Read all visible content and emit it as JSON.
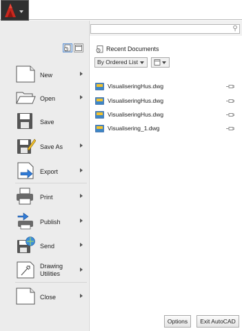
{
  "search": {
    "placeholder": "",
    "value": ""
  },
  "menu": {
    "items": [
      {
        "label": "New",
        "has_submenu": true,
        "icon": "new-document-icon"
      },
      {
        "label": "Open",
        "has_submenu": true,
        "icon": "open-folder-icon"
      },
      {
        "label": "Save",
        "has_submenu": false,
        "icon": "save-disk-icon"
      },
      {
        "label": "Save As",
        "has_submenu": true,
        "icon": "save-as-icon"
      },
      {
        "label": "Export",
        "has_submenu": true,
        "icon": "export-icon"
      },
      {
        "label": "Print",
        "has_submenu": true,
        "icon": "printer-icon"
      },
      {
        "label": "Publish",
        "has_submenu": true,
        "icon": "publish-icon"
      },
      {
        "label": "Send",
        "has_submenu": true,
        "icon": "send-icon"
      },
      {
        "label": "Drawing Utilities",
        "line1": "Drawing",
        "line2": "Utilities",
        "has_submenu": true,
        "icon": "drawing-utilities-icon"
      },
      {
        "label": "Close",
        "has_submenu": true,
        "icon": "close-document-icon"
      }
    ]
  },
  "recent": {
    "title": "Recent Documents",
    "order_by": "By Ordered List",
    "documents": [
      {
        "name": "VisualiseringHus.dwg"
      },
      {
        "name": "VisualiseringHus.dwg"
      },
      {
        "name": "VisualiseringHus.dwg"
      },
      {
        "name": "Visualisering_1.dwg"
      }
    ]
  },
  "buttons": {
    "options": "Options",
    "exit": "Exit AutoCAD"
  },
  "colors": {
    "app_button_red": "#c8281e",
    "panel_bg": "#ececec",
    "selected_toggle": "#d9e8f8"
  }
}
